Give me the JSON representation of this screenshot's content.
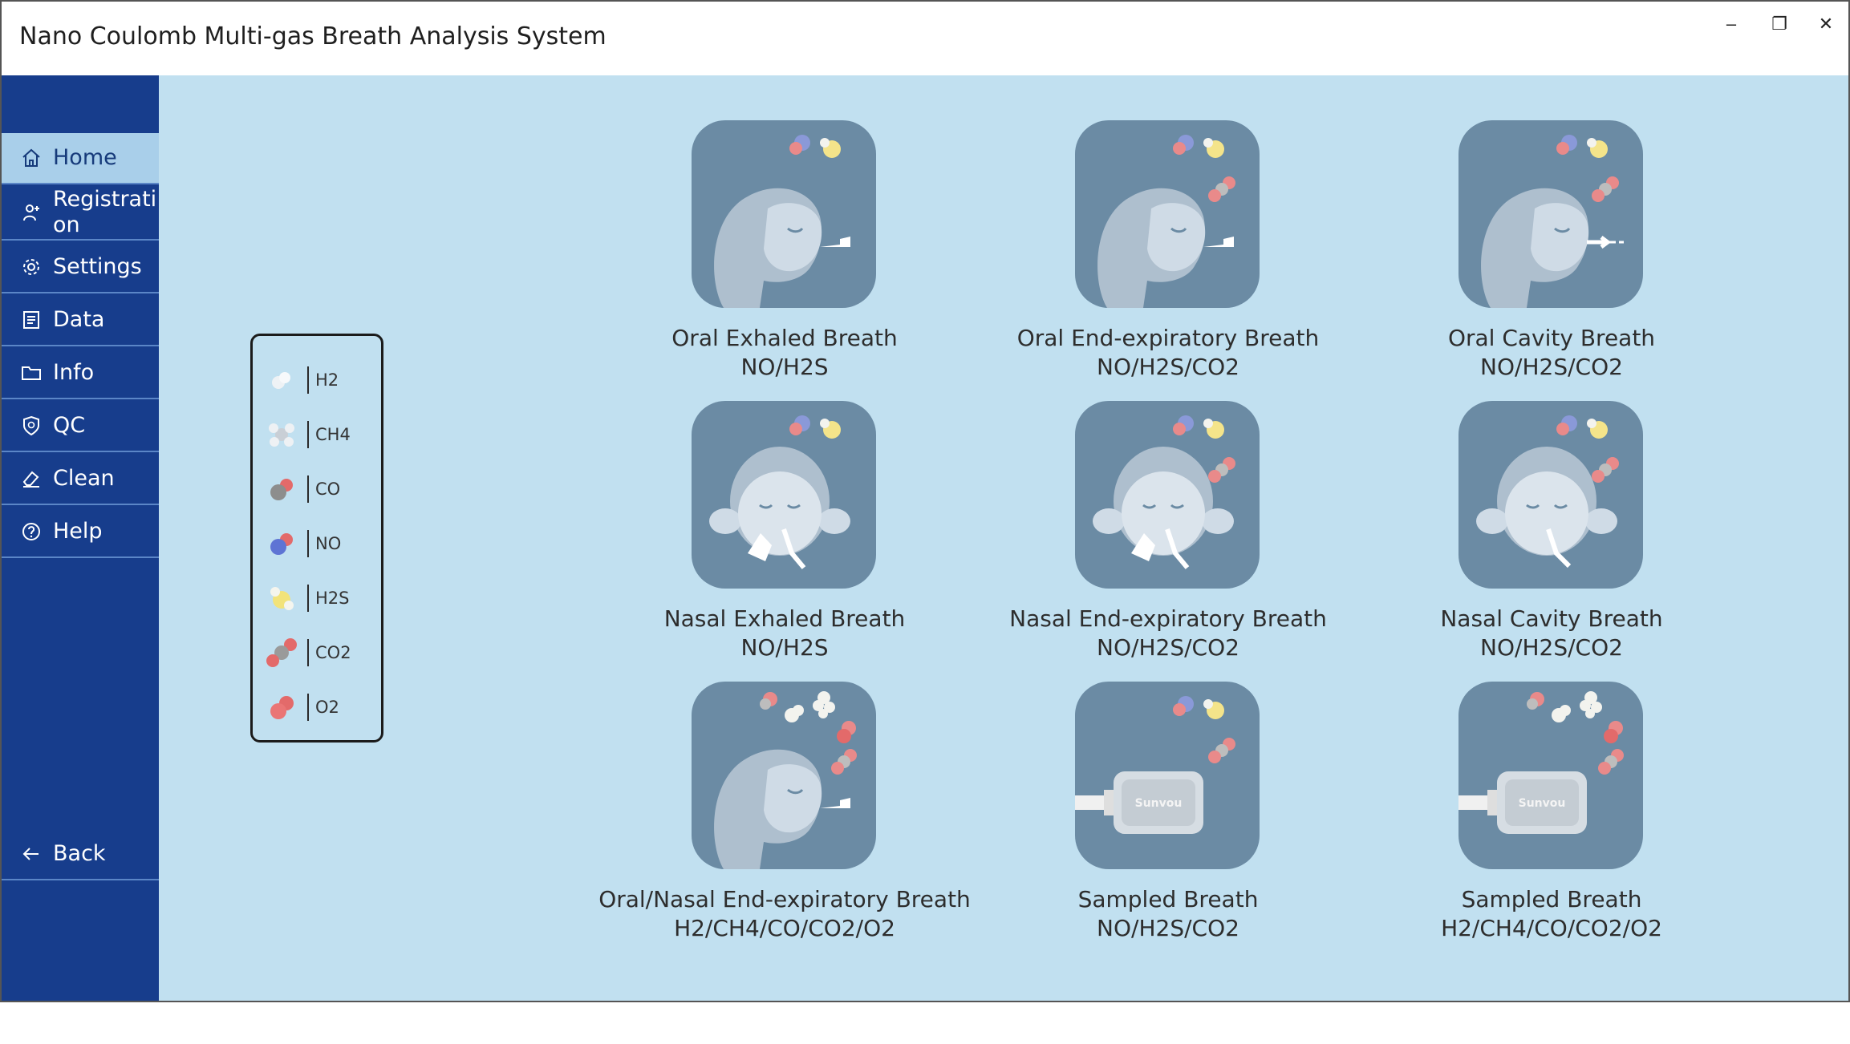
{
  "window": {
    "title": "Nano Coulomb Multi-gas Breath Analysis System",
    "controls": {
      "minimize": "–",
      "maximize": "❐",
      "close": "✕"
    }
  },
  "sidebar": {
    "items": [
      {
        "label": "Home",
        "icon": "home-icon",
        "active": true
      },
      {
        "label": "Registration",
        "icon": "add-user-icon",
        "active": false
      },
      {
        "label": "Settings",
        "icon": "gear-icon",
        "active": false
      },
      {
        "label": "Data",
        "icon": "document-icon",
        "active": false
      },
      {
        "label": "Info",
        "icon": "folder-icon",
        "active": false
      },
      {
        "label": "QC",
        "icon": "shield-qc-icon",
        "active": false
      },
      {
        "label": "Clean",
        "icon": "eraser-icon",
        "active": false
      },
      {
        "label": "Help",
        "icon": "question-icon",
        "active": false
      }
    ],
    "back": {
      "label": "Back",
      "icon": "arrow-left-icon"
    },
    "brand": "Sunvou"
  },
  "legend": {
    "items": [
      {
        "gas": "H2"
      },
      {
        "gas": "CH4"
      },
      {
        "gas": "CO"
      },
      {
        "gas": "NO"
      },
      {
        "gas": "H2S"
      },
      {
        "gas": "CO2"
      },
      {
        "gas": "O2"
      }
    ]
  },
  "tests": [
    {
      "name": "Oral Exhaled Breath",
      "gases": "NO/H2S"
    },
    {
      "name": "Oral End-expiratory Breath",
      "gases": "NO/H2S/CO2"
    },
    {
      "name": "Oral Cavity Breath",
      "gases": "NO/H2S/CO2"
    },
    {
      "name": "Nasal Exhaled Breath",
      "gases": "NO/H2S"
    },
    {
      "name": "Nasal End-expiratory Breath",
      "gases": "NO/H2S/CO2"
    },
    {
      "name": "Nasal Cavity Breath",
      "gases": "NO/H2S/CO2"
    },
    {
      "name": "Oral/Nasal End-expiratory Breath",
      "gases": "H2/CH4/CO/CO2/O2"
    },
    {
      "name": "Sampled Breath",
      "gases": "NO/H2S/CO2"
    },
    {
      "name": "Sampled Breath",
      "gases": "H2/CH4/CO/CO2/O2"
    }
  ],
  "bag_logo_text": "Sunvou",
  "colors": {
    "sidebar": "#173d8c",
    "sidebar_active": "#a9cfea",
    "main_bg": "#c1e0f0",
    "tile_bg": "#6b8ba4"
  }
}
